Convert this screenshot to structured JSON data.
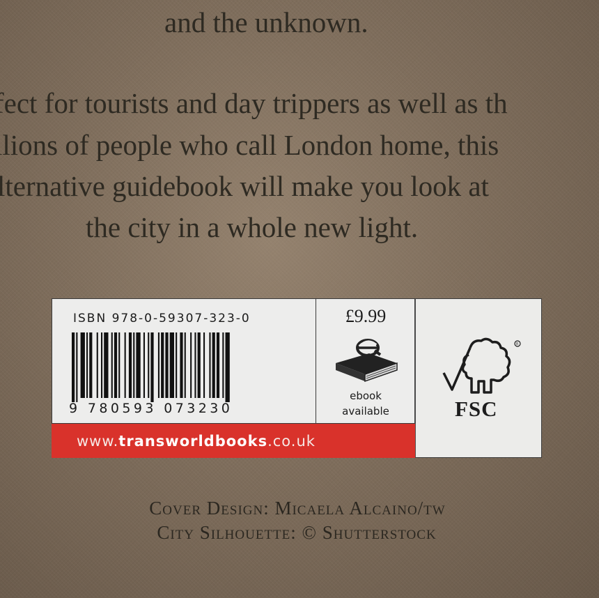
{
  "blurb": {
    "lines": [
      "and the unknown.",
      "fect for tourists and day trippers as well as th",
      "llions of people who call London home, this",
      "lternative guidebook will make you look at",
      "the city in a whole new light."
    ]
  },
  "barcode": {
    "isbn_label": "ISBN  978-0-59307-323-0",
    "digits": "9 780593 073230"
  },
  "price": {
    "value": "£9.99",
    "ebook_line1": "ebook",
    "ebook_line2": "available",
    "icon": "ebook-book-icon"
  },
  "fsc": {
    "label": "FSC",
    "icon": "fsc-tree-checkmark-logo"
  },
  "website": {
    "prefix": "www.",
    "domain": "transworldbooks",
    "suffix": ".co.uk",
    "color": "#d9322b"
  },
  "credits": {
    "line1": "Cover Design: Micaela Alcaino/tw",
    "line2": "City Silhouette: © Shutterstock"
  }
}
